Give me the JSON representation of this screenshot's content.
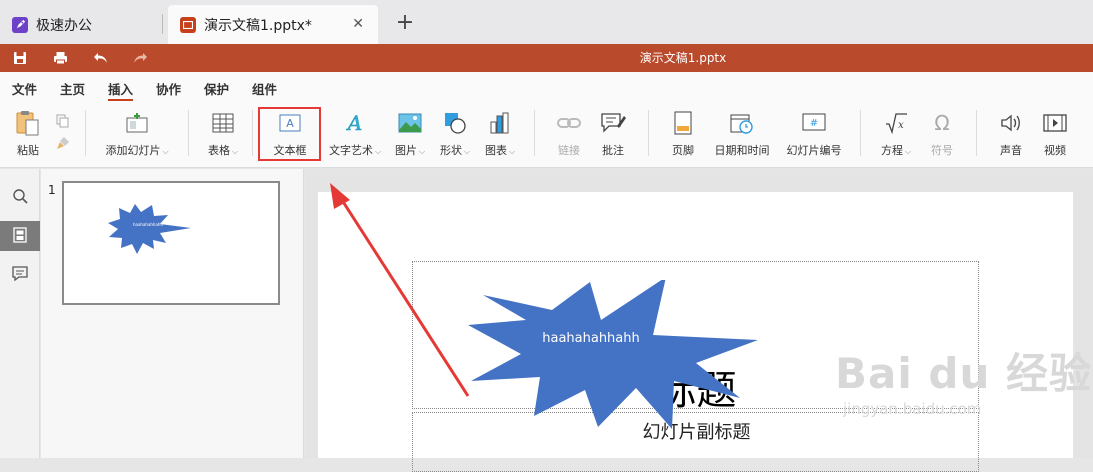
{
  "tabs": [
    {
      "label": "极速办公",
      "icon": "rocket-icon"
    },
    {
      "label": "演示文稿1.pptx*",
      "icon": "presentation-icon",
      "active": true
    }
  ],
  "titlebar": {
    "doc_title": "演示文稿1.pptx",
    "color": "#b94a2c"
  },
  "menu": {
    "items": [
      "文件",
      "主页",
      "插入",
      "协作",
      "保护",
      "组件"
    ],
    "active": "插入"
  },
  "ribbon": {
    "paste": "粘贴",
    "add_slide": "添加幻灯片",
    "table": "表格",
    "textbox": "文本框",
    "wordart": "文字艺术",
    "image": "图片",
    "shape": "形状",
    "chart": "图表",
    "link": "链接",
    "comment": "批注",
    "footer": "页脚",
    "datetime": "日期和时间",
    "slide_number": "幻灯片编号",
    "equation": "方程",
    "symbol": "符号",
    "audio": "声音",
    "video": "视频"
  },
  "thumbnail": {
    "number": "1"
  },
  "slide": {
    "title": "标题",
    "subtitle": "幻灯片副标题",
    "burst_text": "haahahahhahh",
    "burst_color": "#4472c4"
  },
  "watermark": {
    "logo": "Bai du 经验",
    "url": "jingyan.baidu.com"
  },
  "accent": "#e53935"
}
